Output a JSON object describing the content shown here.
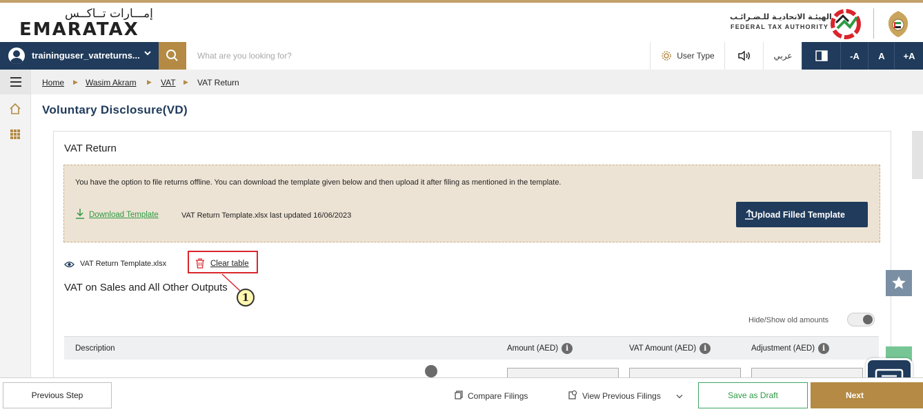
{
  "brand": {
    "logo_arabic": "إمـــارات تــاكــس",
    "logo_english": "EMARATAX",
    "authority_arabic": "الهيئـة الاتحاديـة للـضـرائـب",
    "authority_english": "FEDERAL TAX AUTHORITY"
  },
  "navbar": {
    "user_name": "traininguser_vatreturns...",
    "search_placeholder": "What are you looking for?",
    "user_type_label": "User Type",
    "arabic_label": "عربي",
    "font_decrease": "-A",
    "font_normal": "A",
    "font_increase": "+A"
  },
  "breadcrumb": {
    "items": [
      "Home",
      "Wasim Akram",
      "VAT",
      "VAT Return"
    ]
  },
  "page": {
    "title": "Voluntary Disclosure(VD)"
  },
  "vat_return": {
    "card_title": "VAT Return",
    "info_text": "You have the option to file returns offline. You can download the template given below and then upload it after filing as mentioned in the template.",
    "download_label": "Download Template",
    "template_meta": "VAT Return Template.xlsx last updated 16/06/2023",
    "upload_label": "Upload Filled Template",
    "uploaded_file": "VAT Return Template.xlsx",
    "clear_label": "Clear table",
    "callout_number": "1",
    "section_title": "VAT on Sales and All Other Outputs",
    "toggle_label": "Hide/Show old amounts",
    "columns": [
      "Description",
      "Amount (AED)",
      "VAT Amount (AED)",
      "Adjustment (AED)"
    ]
  },
  "footer": {
    "previous_label": "Previous Step",
    "compare_label": "Compare Filings",
    "view_previous_label": "View Previous Filings",
    "save_draft_label": "Save as Draft",
    "next_label": "Next"
  },
  "colors": {
    "navy": "#203b5b",
    "gold": "#b48a44",
    "green": "#2e9a44",
    "info_bg": "#ede3d4",
    "highlight_red": "#d9252b"
  }
}
